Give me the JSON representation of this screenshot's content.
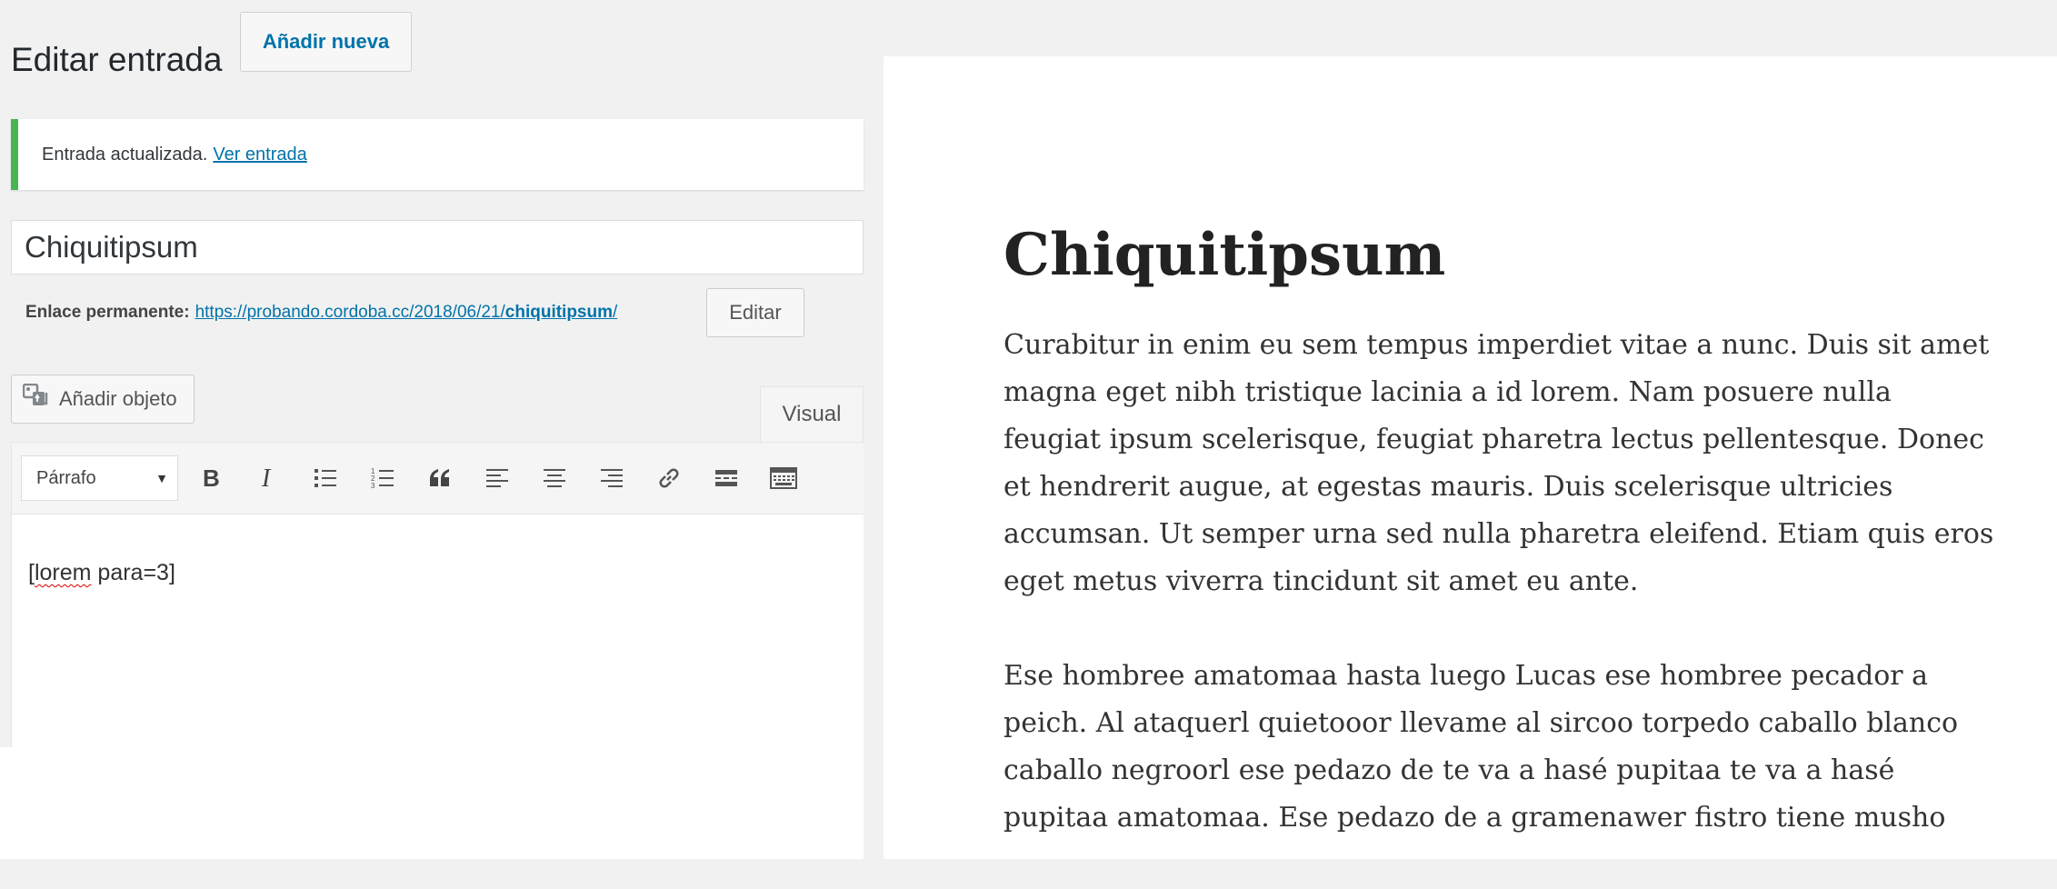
{
  "header": {
    "title": "Editar entrada",
    "add_new_label": "Añadir nueva"
  },
  "notice": {
    "message": "Entrada actualizada.",
    "link_label": "Ver entrada",
    "color": "#46b450"
  },
  "post": {
    "title": "Chiquitipsum",
    "permalink_label": "Enlace permanente:",
    "permalink_base": "https://probando.cordoba.cc/2018/06/21/",
    "permalink_slug": "chiquitipsum",
    "permalink_trailing": "/",
    "edit_slug_label": "Editar"
  },
  "editor": {
    "add_media_label": "Añadir objeto",
    "visual_tab_label": "Visual",
    "format_select_value": "Párrafo",
    "toolbar_buttons": [
      "bold-icon",
      "italic-icon",
      "bulleted-list-icon",
      "numbered-list-icon",
      "blockquote-icon",
      "align-left-icon",
      "align-center-icon",
      "align-right-icon",
      "link-icon",
      "read-more-icon",
      "toolbar-toggle-icon"
    ],
    "content_word": "lorem",
    "content_rest": " para=3]",
    "content_prefix": "["
  },
  "preview": {
    "title": "Chiquitipsum",
    "paragraphs": [
      "Curabitur in enim eu sem tempus imperdiet vitae a nunc. Duis sit amet magna eget nibh tristique lacinia a id lorem. Nam posuere nulla feugiat ipsum scelerisque, feugiat pharetra lectus pellentesque. Donec et hendrerit augue, at egestas mauris. Duis scelerisque ultricies accumsan. Ut semper urna sed nulla pharetra eleifend. Etiam quis eros eget metus viverra tincidunt sit amet eu ante.",
      "Ese hombree amatomaa hasta luego Lucas ese hombree pecador a peich. Al ataquerl quietooor llevame al sircoo torpedo caballo blanco caballo negroorl ese pedazo de te va a hasé pupitaa te va a hasé pupitaa amatomaa. Ese pedazo de a gramenawer fistro tiene musho"
    ]
  },
  "colors": {
    "link": "#0073aa",
    "admin_background": "#f1f1f1"
  }
}
